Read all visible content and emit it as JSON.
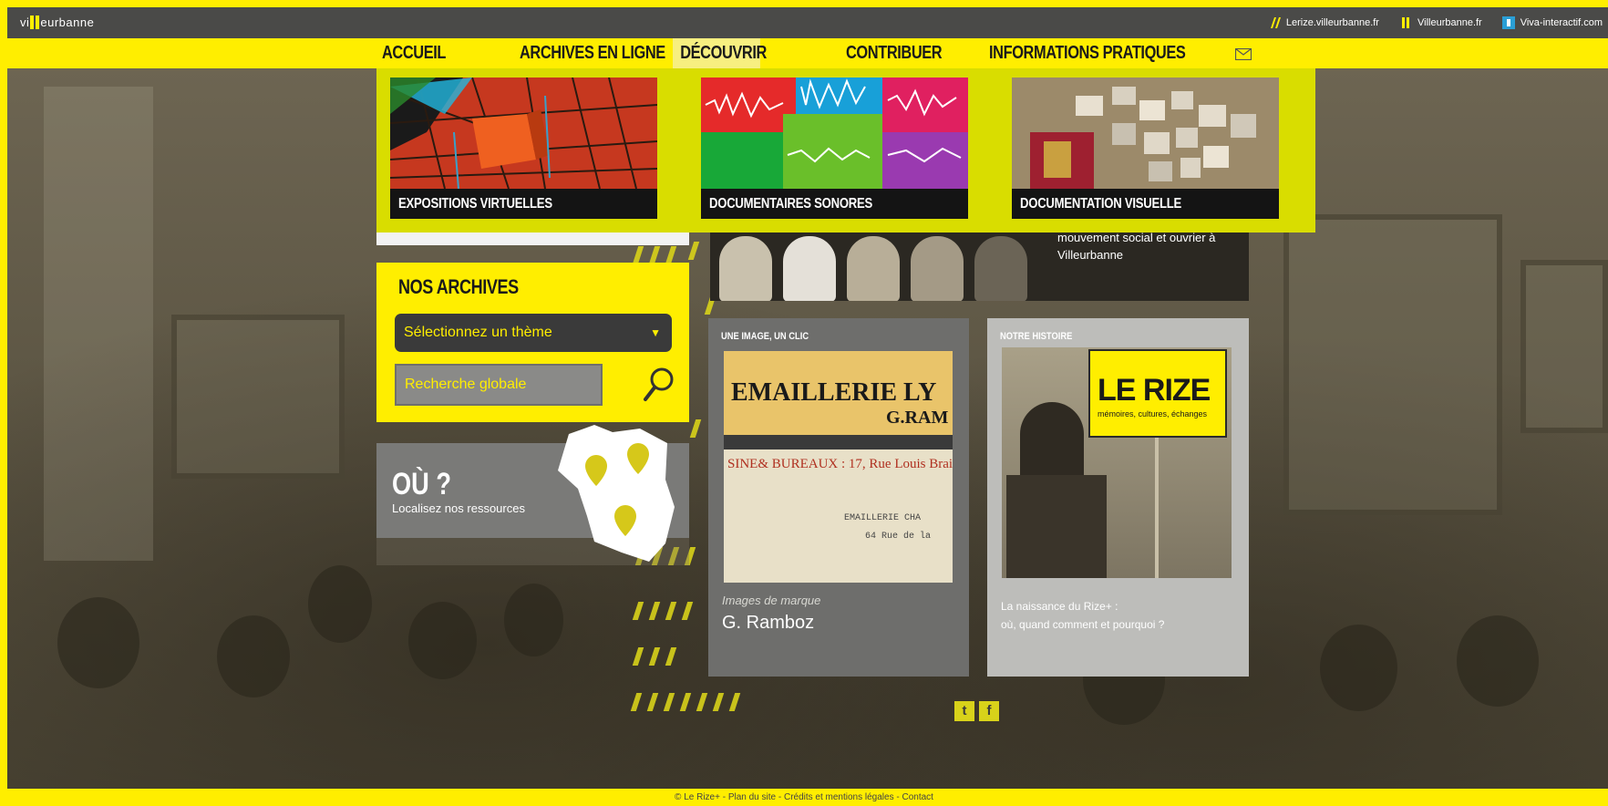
{
  "brand": {
    "logo_prefix": "vi",
    "logo_suffix": "eurbanne",
    "accent": "#ffee00"
  },
  "top_links": [
    {
      "label": "Lerize.villeurbanne.fr",
      "icon": "rize-slash-icon"
    },
    {
      "label": "Villeurbanne.fr",
      "icon": "villeurbanne-bars-icon"
    },
    {
      "label": "Viva-interactif.com",
      "icon": "viva-icon"
    }
  ],
  "nav": {
    "items": [
      {
        "label": "ACCUEIL"
      },
      {
        "label": "ARCHIVES EN LIGNE"
      },
      {
        "label": "DÉCOUVRIR"
      },
      {
        "label": "CONTRIBUER"
      },
      {
        "label": "INFORMATIONS PRATIQUES"
      }
    ],
    "active": "DÉCOUVRIR"
  },
  "dropdown": {
    "cards": [
      {
        "caption": "EXPOSITIONS VIRTUELLES"
      },
      {
        "caption": "DOCUMENTAIRES SONORES"
      },
      {
        "caption": "DOCUMENTATION VISUELLE"
      }
    ]
  },
  "strip": {
    "text": "mouvement social et ouvrier à Villeurbanne"
  },
  "archives": {
    "title": "NOS ARCHIVES",
    "select_value": "Sélectionnez un thème",
    "search_placeholder": "Recherche globale"
  },
  "ou": {
    "title": "OÙ ?",
    "subtitle": "Localisez nos ressources"
  },
  "card_image": {
    "title": "UNE IMAGE, UN CLIC",
    "pic_text_1": "EMAILLERIE LY",
    "pic_text_2": "G.RAM",
    "pic_text_3": "SINE& BUREAUX : 17, Rue Louis Brai",
    "pic_text_4": "EMAILLERIE CHA",
    "pic_text_5": "64 Rue de la",
    "subtitle": "Images de marque",
    "name": "G. Ramboz"
  },
  "card_history": {
    "title": "NOTRE HISTOIRE",
    "sign_main": "LE RIZE",
    "sign_sub": "mémoires, cultures, échanges",
    "line1": "La naissance du Rize+ :",
    "line2": "où, quand comment et pourquoi ?"
  },
  "social": {
    "twitter": "t",
    "facebook": "f"
  },
  "footer": {
    "text": "© Le Rize+ - Plan du site - Crédits et mentions légales - Contact"
  }
}
